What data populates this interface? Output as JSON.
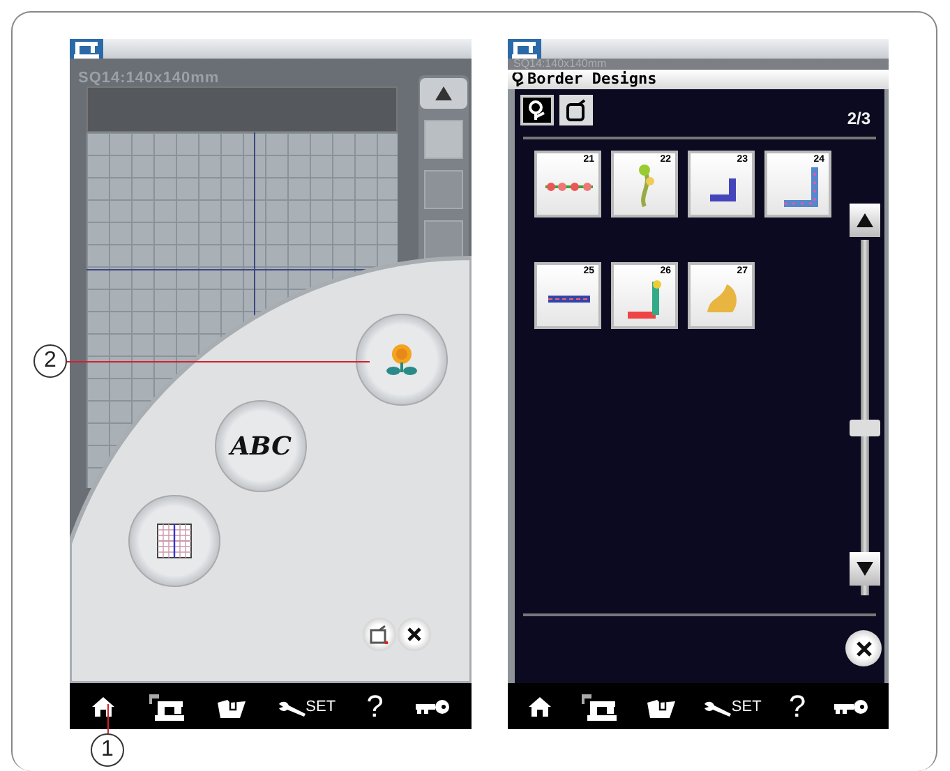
{
  "callouts": [
    {
      "label": "2"
    },
    {
      "label": "1"
    }
  ],
  "left_screen": {
    "size_label": "SQ14:140x140mm",
    "menu_buttons": [
      {
        "kind": "design"
      },
      {
        "kind": "text",
        "label": "ABC"
      },
      {
        "kind": "grid"
      }
    ],
    "taskbar": [
      {
        "kind": "home"
      },
      {
        "kind": "machine"
      },
      {
        "kind": "folder"
      },
      {
        "kind": "settings",
        "label": "SET"
      },
      {
        "kind": "help",
        "label": "?"
      },
      {
        "kind": "key"
      }
    ]
  },
  "right_screen": {
    "ghost_label": "SQ14:140x140mm",
    "title": "Border Designs",
    "tabs": [
      {
        "kind": "design",
        "selected": true
      },
      {
        "kind": "frame",
        "selected": false
      }
    ],
    "page": "2/3",
    "designs": [
      {
        "number": "21",
        "kind": "flower-row"
      },
      {
        "number": "22",
        "kind": "flower-stem"
      },
      {
        "number": "23",
        "kind": "corner-small"
      },
      {
        "number": "24",
        "kind": "corner-large"
      },
      {
        "number": "25",
        "kind": "band"
      },
      {
        "number": "26",
        "kind": "corner-color"
      },
      {
        "number": "27",
        "kind": "bird"
      }
    ],
    "taskbar": [
      {
        "kind": "home"
      },
      {
        "kind": "machine"
      },
      {
        "kind": "folder"
      },
      {
        "kind": "settings",
        "label": "SET"
      },
      {
        "kind": "help",
        "label": "?"
      },
      {
        "kind": "key"
      }
    ]
  }
}
